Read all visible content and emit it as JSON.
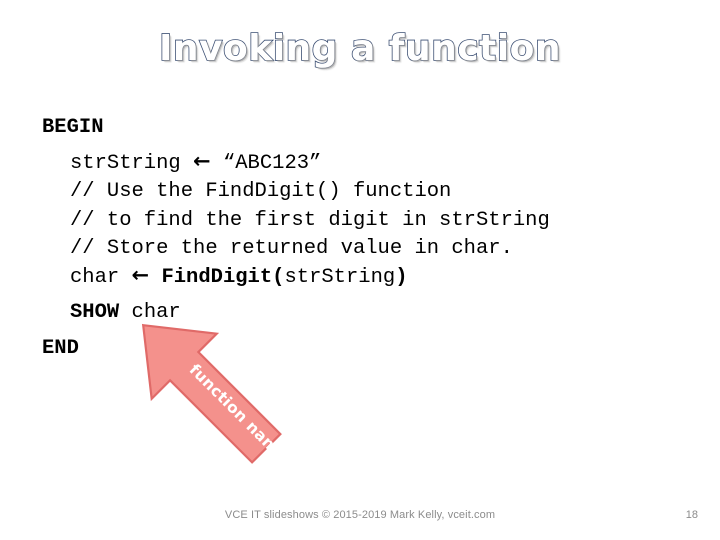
{
  "slide": {
    "title": "Invoking a function",
    "background_color": "#FFFFFF",
    "title_fill_color": "#FFFFFF",
    "title_outline_color": "#3C4F73"
  },
  "code": {
    "lines": [
      {
        "id": "begin",
        "segments": [
          {
            "text": "BEGIN",
            "bold": true
          }
        ]
      },
      {
        "id": "assign",
        "segments": [
          {
            "text": "strString ",
            "bold": false
          },
          {
            "text": "←",
            "bold": true
          },
          {
            "text": " “ABC123”",
            "bold": false
          }
        ]
      },
      {
        "id": "comment1",
        "segments": [
          {
            "text": "// Use the FindDigit() function",
            "bold": false
          }
        ]
      },
      {
        "id": "comment2",
        "segments": [
          {
            "text": "// to find the first digit in strString",
            "bold": false
          }
        ]
      },
      {
        "id": "comment3",
        "segments": [
          {
            "text": "// Store the returned value in char.",
            "bold": false
          }
        ]
      },
      {
        "id": "call",
        "segments": [
          {
            "text": "char ",
            "bold": false
          },
          {
            "text": "←",
            "bold": true
          },
          {
            "text": " ",
            "bold": false
          },
          {
            "text": "FindDigit(",
            "bold": true
          },
          {
            "text": "strString",
            "bold": false
          },
          {
            "text": ")",
            "bold": true
          }
        ]
      },
      {
        "id": "show",
        "segments": [
          {
            "text": "SHOW",
            "bold": true
          },
          {
            "text": " char",
            "bold": false
          }
        ]
      },
      {
        "id": "end",
        "segments": [
          {
            "text": "END",
            "bold": true
          }
        ]
      }
    ],
    "line_begin": "BEGIN",
    "line_assign": "strString ← “ABC123”",
    "line_comment_1": "// Use the FindDigit() function",
    "line_comment_2": "// to find the first digit in strString",
    "line_comment_3": "// Store the returned value in char.",
    "line_call": "char ← FindDigit(strString)",
    "line_show": "SHOW char",
    "line_end": "END"
  },
  "callout": {
    "label": "function name",
    "fill_color": "#F4918C",
    "outline_color": "#E06A68",
    "label_color": "#FFFFFF",
    "points_at": "FindDigit"
  },
  "footer": {
    "credit": "VCE IT slideshows © 2015-2019 Mark Kelly, vceit.com",
    "page_number": "18",
    "text_color": "#8C8C8C"
  }
}
